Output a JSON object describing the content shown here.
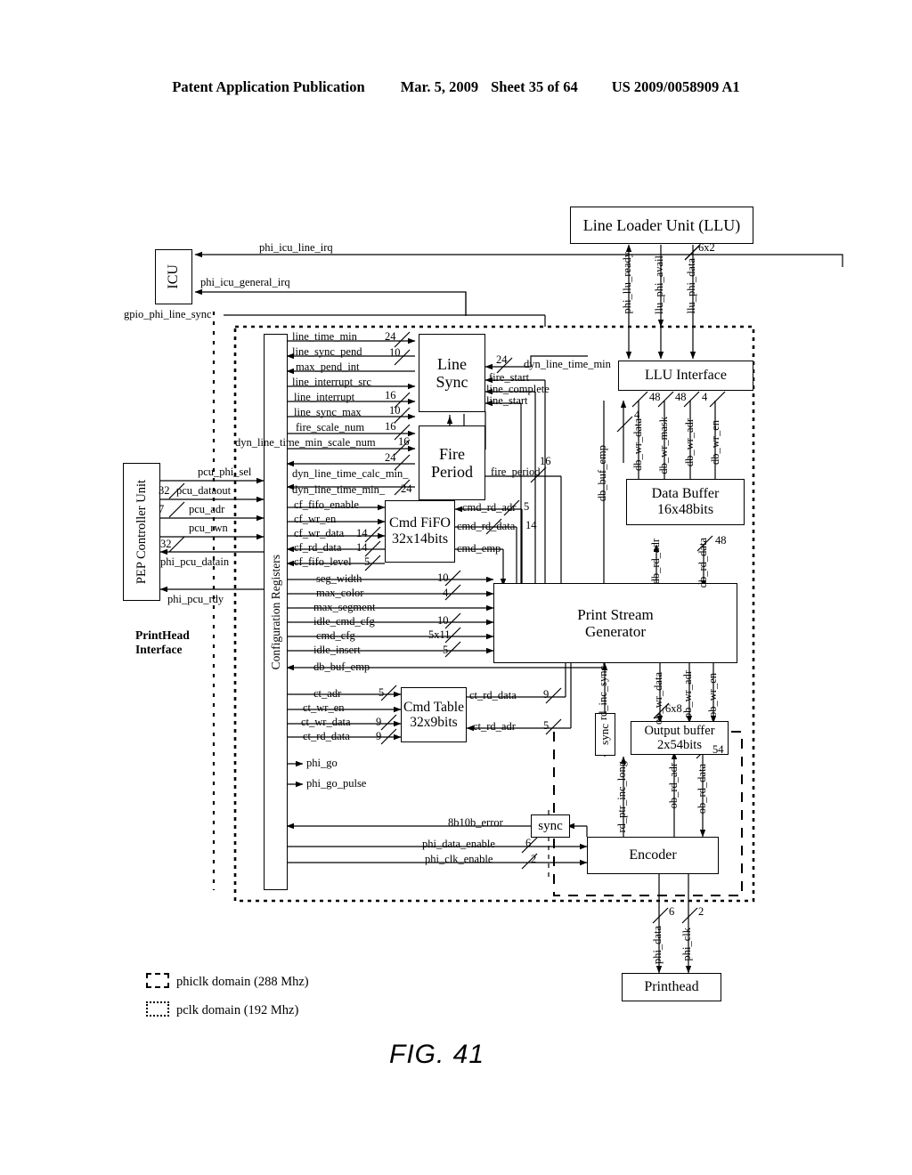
{
  "header": {
    "publication": "Patent Application Publication",
    "date": "Mar. 5, 2009",
    "sheet": "Sheet 35 of 64",
    "patent_number": "US 2009/0058909 A1"
  },
  "figure": {
    "caption": "FIG. 41"
  },
  "blocks": {
    "icu": "ICU",
    "llu": "Line Loader Unit (LLU)",
    "llu_interface": "LLU Interface",
    "pep": "PEP Controller Unit",
    "config_registers": "Configuration Registers",
    "line_sync_l1": "Line",
    "line_sync_l2": "Sync",
    "fire_period_l1": "Fire",
    "fire_period_l2": "Period",
    "cmd_fifo_l1": "Cmd FiFO",
    "cmd_fifo_l2": "32x14bits",
    "cmd_table_l1": "Cmd Table",
    "cmd_table_l2": "32x9bits",
    "data_buffer_l1": "Data Buffer",
    "data_buffer_l2": "16x48bits",
    "print_stream_l1": "Print Stream",
    "print_stream_l2": "Generator",
    "output_buffer_l1": "Output buffer",
    "output_buffer_l2": "2x54bits",
    "encoder": "Encoder",
    "sync_top": "sync",
    "sync_bottom": "sync",
    "printhead": "Printhead",
    "printhead_interface_l1": "PrintHead",
    "printhead_interface_l2": "Interface"
  },
  "signals": {
    "phi_icu_line_irq": "phi_icu_line_irq",
    "phi_icu_general_irq": "phi_icu_general_irq",
    "gpio_phi_line_sync": "gpio_phi_line_sync",
    "phi_llu_ready": "phi_llu_ready",
    "llu_phi_avail": "llu_phi_avail",
    "llu_phi_data": "llu_phi_data",
    "line_time_min": "line_time_min",
    "line_sync_pend": "line_sync_pend",
    "max_pend_int": "max_pend_int",
    "line_interrupt_src": "line_interrupt_src",
    "line_interrupt": "line_interrupt",
    "line_sync_max": "line_sync_max",
    "fire_scale_num": "fire_scale_num",
    "dyn_line_time_min_scale_num": "dyn_line_time_min_scale_num",
    "dyn_line_time_calc_min": "dyn_line_time_calc_min_",
    "dyn_line_time_min_cfg": "dyn_line_time_min_",
    "dyn_line_time_min": "dyn_line_time_min",
    "fire_start": "fire_start",
    "line_complete": "line_complete",
    "line_start": "line_start",
    "fire_period": "fire_period",
    "cf_fifo_enable": "cf_fifo_enable",
    "cf_wr_en": "cf_wr_en",
    "cf_wr_data": "cf_wr_data",
    "cf_rd_data": "cf_rd_data",
    "cf_fifo_level": "cf_fifo_level",
    "seg_width": "seg_width",
    "max_color": "max_color",
    "max_segment": "max_segment",
    "idle_cmd_cfg": "idle_cmd_cfg",
    "cmd_cfg": "cmd_cfg",
    "idle_insert": "idle_insert",
    "db_buf_emp_cfg": "db_buf_emp",
    "db_buf_emp": "db_buf_emp",
    "cmd_rd_adr": "cmd_rd_adr",
    "cmd_rd_data": "cmd_rd_data",
    "cmd_emp": "cmd_emp",
    "ct_adr": "ct_adr",
    "ct_wr_en": "ct_wr_en",
    "ct_wr_data": "ct_wr_data",
    "ct_rd_data_in": "ct_rd_data",
    "ct_rd_data_out": "ct_rd_data",
    "ct_rd_adr": "ct_rd_adr",
    "phi_go": "phi_go",
    "phi_go_pulse": "phi_go_pulse",
    "err_8b10b": "8b10b_error",
    "phi_data_enable": "phi_data_enable",
    "phi_clk_enable": "phi_clk_enable",
    "pcu_phi_sel": "pcu_phi_sel",
    "pcu_dataout": "pcu_dataout",
    "pcu_adr": "pcu_adr",
    "pcu_rwn": "pcu_rwn",
    "phi_pcu_datain": "phi_pcu_datain",
    "phi_pcu_rdy": "phi_pcu_rdy",
    "db_wr_data": "db_wr_data",
    "db_wr_mask": "db_wr_mask",
    "db_wr_adr": "db_wr_adr",
    "db_wr_en": "db_wr_en",
    "db_rd_adr": "db_rd_adr",
    "db_rd_data": "db_rd_data",
    "ob_wr_data": "ob_wr_data",
    "ob_wr_adr": "ob_wr_adr",
    "ob_wr_en": "ob_wr_en",
    "ob_rd_adr": "ob_rd_adr",
    "ob_rd_data": "ob_rd_data",
    "rd_inc_sync": "rd_inc_sync",
    "rd_ptr_inc_long": "rd_ptr_inc_long",
    "phi_data": "phi_data",
    "phi_clk": "phi_clk"
  },
  "widths": {
    "w6x2": "6x2",
    "w24_a": "24",
    "w10_a": "10",
    "w16_a": "16",
    "w10_b": "10",
    "w16_b": "16",
    "w16_c": "16",
    "w24_b": "24",
    "w24_c": "24",
    "w24_d": "24",
    "w16_fire": "16",
    "w48_a": "48",
    "w48_b": "48",
    "w4_a": "4",
    "w4_b": "4",
    "w48_rd": "48",
    "w14_a": "14",
    "w14_b": "14",
    "w5_a": "5",
    "w5_cmdadr": "5",
    "w14_cmdrd": "14",
    "w10_seg": "10",
    "w4_color": "4",
    "w10_idle": "10",
    "w5x11": "5x11",
    "w5_insert": "5",
    "w5_ctadr": "5",
    "w9_ctwr": "9",
    "w9_ctrd": "9",
    "w9_ctrddata": "9",
    "w5_ctrdadr": "5",
    "w6x8": "6x8",
    "w54": "54",
    "w6_data": "6",
    "w2_clk": "2",
    "w6_phi": "6",
    "w2_phi": "2",
    "w32_a": "32",
    "w7_adr": "7",
    "w32_b": "32"
  },
  "legend": {
    "phiclk": "phiclk domain (288 Mhz)",
    "pclk": "pclk domain (192 Mhz)"
  }
}
